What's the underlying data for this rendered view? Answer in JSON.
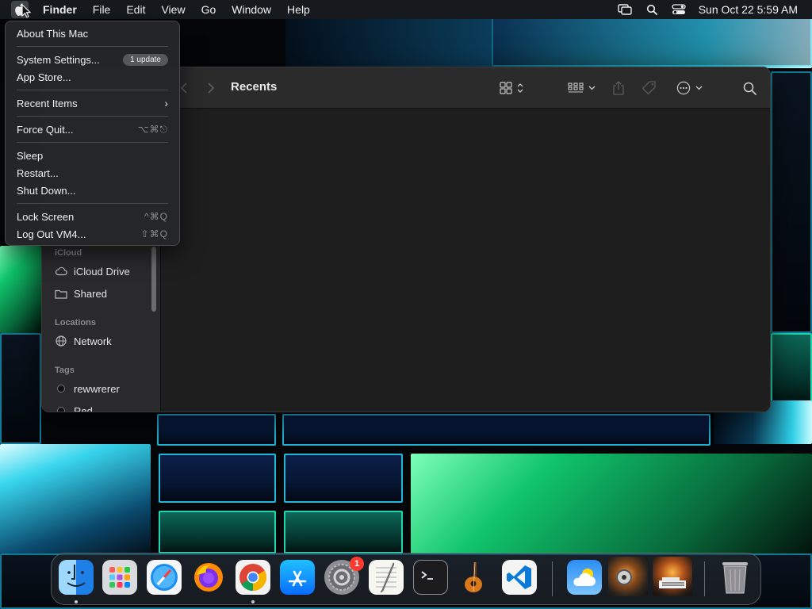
{
  "menubar": {
    "app_name": "Finder",
    "menus": [
      "File",
      "Edit",
      "View",
      "Go",
      "Window",
      "Help"
    ],
    "status_icons": [
      "screen-mirroring-icon",
      "spotlight-search-icon",
      "control-center-icon"
    ],
    "clock": "Sun Oct 22  5:59 AM"
  },
  "apple_menu": {
    "items": [
      {
        "label": "About This Mac"
      },
      {
        "label": "System Settings...",
        "badge": "1 update"
      },
      {
        "label": "App Store..."
      },
      {
        "label": "Recent Items",
        "submenu": true
      },
      {
        "label": "Force Quit...",
        "shortcut": "⌥⌘⎋"
      },
      {
        "label": "Sleep"
      },
      {
        "label": "Restart..."
      },
      {
        "label": "Shut Down..."
      },
      {
        "label": "Lock Screen",
        "shortcut": "^⌘Q"
      },
      {
        "label": "Log Out VM4...",
        "shortcut": "⇧⌘Q"
      }
    ]
  },
  "finder": {
    "title": "Recents",
    "toolbar_icons": [
      "back-icon",
      "forward-icon",
      "view-mode-icon",
      "group-icon",
      "share-icon",
      "tag-icon",
      "more-actions-icon",
      "search-icon"
    ],
    "sidebar": {
      "sections": [
        {
          "header": "iCloud",
          "items": [
            {
              "label": "iCloud Drive",
              "icon": "cloud-icon"
            },
            {
              "label": "Shared",
              "icon": "shared-folder-icon"
            }
          ]
        },
        {
          "header": "Locations",
          "items": [
            {
              "label": "Network",
              "icon": "globe-icon"
            }
          ]
        },
        {
          "header": "Tags",
          "items": [
            {
              "label": "rewwrerer",
              "icon": "tag-dot-icon"
            },
            {
              "label": "Red",
              "icon": "tag-dot-icon"
            }
          ]
        }
      ]
    }
  },
  "dock": {
    "apps": [
      "Finder",
      "Launchpad",
      "Safari",
      "Firefox",
      "Google Chrome",
      "App Store",
      "System Settings",
      "TextEdit",
      "Terminal",
      "GarageBand",
      "Visual Studio Code"
    ],
    "system_settings_badge": "1",
    "others": [
      "Weather",
      "image-thumbnail-1",
      "image-thumbnail-2",
      "Trash"
    ]
  },
  "colors": {
    "menubar_bg": "#161a1f",
    "menu_bg": "#24262a",
    "finder_bg": "#1e1e1e",
    "badge_red": "#ff3b30"
  }
}
